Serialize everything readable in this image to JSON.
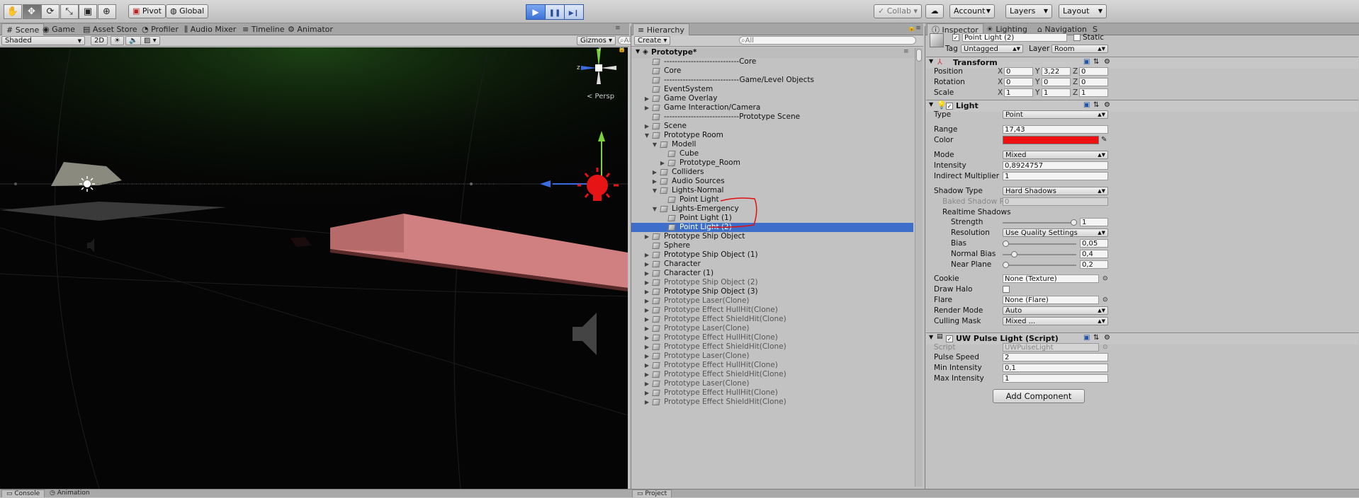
{
  "toolbar": {
    "tools": [
      {
        "icon": "hand-tool-icon",
        "glyph": "✋"
      },
      {
        "icon": "move-tool-icon",
        "glyph": "✥"
      },
      {
        "icon": "rotate-tool-icon",
        "glyph": "⟳"
      },
      {
        "icon": "scale-tool-icon",
        "glyph": "⤡"
      },
      {
        "icon": "rect-tool-icon",
        "glyph": "▣"
      },
      {
        "icon": "transform-tool-icon",
        "glyph": "⊕"
      }
    ],
    "pivot": "Pivot",
    "global": "Global",
    "play_glyph": "▶",
    "pause_glyph": "❚❚",
    "step_glyph": "▶❙",
    "collab": "Collab ▾",
    "account": "Account",
    "layers": "Layers",
    "layout": "Layout"
  },
  "scene_tabs": [
    "Scene",
    "Game",
    "Asset Store",
    "Profiler",
    "Audio Mixer",
    "Timeline",
    "Animator"
  ],
  "scene_bar": {
    "shading": "Shaded",
    "mode2d": "2D",
    "gizmos": "Gizmos",
    "search_placeholder": "All"
  },
  "scene_view": {
    "persp_label": "< Persp",
    "axis_y": "y",
    "axis_z": "z"
  },
  "hierarchy": {
    "tab": "Hierarchy",
    "create": "Create",
    "search_placeholder": "All",
    "root": "Prototype*",
    "rows": [
      {
        "label": "----------------------------Core",
        "indent": 0,
        "fold": "",
        "dim": false
      },
      {
        "label": "Core",
        "indent": 0,
        "fold": "",
        "dim": false
      },
      {
        "label": "----------------------------Game/Level Objects",
        "indent": 0,
        "fold": "",
        "dim": false
      },
      {
        "label": "EventSystem",
        "indent": 0,
        "fold": "",
        "dim": false
      },
      {
        "label": "Game Overlay",
        "indent": 0,
        "fold": "▶",
        "dim": false
      },
      {
        "label": "Game Interaction/Camera",
        "indent": 0,
        "fold": "▶",
        "dim": false
      },
      {
        "label": "----------------------------Prototype Scene",
        "indent": 0,
        "fold": "",
        "dim": false
      },
      {
        "label": "Scene",
        "indent": 0,
        "fold": "▶",
        "dim": false
      },
      {
        "label": "Prototype Room",
        "indent": 0,
        "fold": "▼",
        "dim": false
      },
      {
        "label": "Modell",
        "indent": 1,
        "fold": "▼",
        "dim": false
      },
      {
        "label": "Cube",
        "indent": 2,
        "fold": "",
        "dim": false
      },
      {
        "label": "Prototype_Room",
        "indent": 2,
        "fold": "▶",
        "dim": false
      },
      {
        "label": "Colliders",
        "indent": 1,
        "fold": "▶",
        "dim": false
      },
      {
        "label": "Audio Sources",
        "indent": 1,
        "fold": "▶",
        "dim": false
      },
      {
        "label": "Lights-Normal",
        "indent": 1,
        "fold": "▼",
        "dim": false
      },
      {
        "label": "Point Light",
        "indent": 2,
        "fold": "",
        "dim": false
      },
      {
        "label": "Lights-Emergency",
        "indent": 1,
        "fold": "▼",
        "dim": false
      },
      {
        "label": "Point Light (1)",
        "indent": 2,
        "fold": "",
        "dim": false
      },
      {
        "label": "Point Light (2)",
        "indent": 2,
        "fold": "",
        "dim": false,
        "selected": true
      },
      {
        "label": "Prototype Ship Object",
        "indent": 0,
        "fold": "▶",
        "dim": false
      },
      {
        "label": "Sphere",
        "indent": 0,
        "fold": "",
        "dim": false
      },
      {
        "label": "Prototype Ship Object (1)",
        "indent": 0,
        "fold": "▶",
        "dim": false
      },
      {
        "label": "Character",
        "indent": 0,
        "fold": "▶",
        "dim": false
      },
      {
        "label": "Character (1)",
        "indent": 0,
        "fold": "▶",
        "dim": false
      },
      {
        "label": "Prototype Ship Object (2)",
        "indent": 0,
        "fold": "▶",
        "dim": true
      },
      {
        "label": "Prototype Ship Object (3)",
        "indent": 0,
        "fold": "▶",
        "dim": false
      },
      {
        "label": "Prototype Laser(Clone)",
        "indent": 0,
        "fold": "▶",
        "dim": true
      },
      {
        "label": "Prototype Effect HullHit(Clone)",
        "indent": 0,
        "fold": "▶",
        "dim": true
      },
      {
        "label": "Prototype Effect ShieldHit(Clone)",
        "indent": 0,
        "fold": "▶",
        "dim": true
      },
      {
        "label": "Prototype Laser(Clone)",
        "indent": 0,
        "fold": "▶",
        "dim": true
      },
      {
        "label": "Prototype Effect HullHit(Clone)",
        "indent": 0,
        "fold": "▶",
        "dim": true
      },
      {
        "label": "Prototype Effect ShieldHit(Clone)",
        "indent": 0,
        "fold": "▶",
        "dim": true
      },
      {
        "label": "Prototype Laser(Clone)",
        "indent": 0,
        "fold": "▶",
        "dim": true
      },
      {
        "label": "Prototype Effect HullHit(Clone)",
        "indent": 0,
        "fold": "▶",
        "dim": true
      },
      {
        "label": "Prototype Effect ShieldHit(Clone)",
        "indent": 0,
        "fold": "▶",
        "dim": true
      },
      {
        "label": "Prototype Laser(Clone)",
        "indent": 0,
        "fold": "▶",
        "dim": true
      },
      {
        "label": "Prototype Effect HullHit(Clone)",
        "indent": 0,
        "fold": "▶",
        "dim": true
      },
      {
        "label": "Prototype Effect ShieldHit(Clone)",
        "indent": 0,
        "fold": "▶",
        "dim": true
      }
    ]
  },
  "inspector": {
    "tabs": [
      "Inspector",
      "Lighting",
      "Navigation",
      "S"
    ],
    "object_name": "Point Light (2)",
    "static_label": "Static",
    "tag_label": "Tag",
    "tag_value": "Untagged",
    "layer_label": "Layer",
    "layer_value": "Room",
    "transform": {
      "title": "Transform",
      "position": {
        "label": "Position",
        "x": "0",
        "y": "3,22",
        "z": "0"
      },
      "rotation": {
        "label": "Rotation",
        "x": "0",
        "y": "0",
        "z": "0"
      },
      "scale": {
        "label": "Scale",
        "x": "1",
        "y": "1",
        "z": "1"
      }
    },
    "light": {
      "title": "Light",
      "type_label": "Type",
      "type_value": "Point",
      "range_label": "Range",
      "range_value": "17,43",
      "color_label": "Color",
      "color_value": "#ee1111",
      "mode_label": "Mode",
      "mode_value": "Mixed",
      "intensity_label": "Intensity",
      "intensity_value": "0,8924757",
      "indirect_label": "Indirect Multiplier",
      "indirect_value": "1",
      "shadow_type_label": "Shadow Type",
      "shadow_type_value": "Hard Shadows",
      "baked_label": "Baked Shadow Ra",
      "baked_value": "0",
      "realtime_label": "Realtime Shadows",
      "strength_label": "Strength",
      "strength_value": "1",
      "strength_level": 1.0,
      "resolution_label": "Resolution",
      "resolution_value": "Use Quality Settings",
      "bias_label": "Bias",
      "bias_value": "0,05",
      "bias_level": 0.0,
      "normal_bias_label": "Normal Bias",
      "normal_bias_value": "0,4",
      "normal_bias_level": 0.13,
      "near_plane_label": "Near Plane",
      "near_plane_value": "0,2",
      "near_plane_level": 0.0,
      "cookie_label": "Cookie",
      "cookie_value": "None (Texture)",
      "halo_label": "Draw Halo",
      "flare_label": "Flare",
      "flare_value": "None (Flare)",
      "render_mode_label": "Render Mode",
      "render_mode_value": "Auto",
      "culling_label": "Culling Mask",
      "culling_value": "Mixed ..."
    },
    "pulse": {
      "title": "UW Pulse Light (Script)",
      "script_label": "Script",
      "script_value": "UWPulseLight",
      "speed_label": "Pulse Speed",
      "speed_value": "2",
      "min_label": "Min Intensity",
      "min_value": "0,1",
      "max_label": "Max Intensity",
      "max_value": "1"
    },
    "add_component": "Add Component"
  },
  "bottom": {
    "console": "Console",
    "animation": "Animation",
    "project": "Project"
  }
}
